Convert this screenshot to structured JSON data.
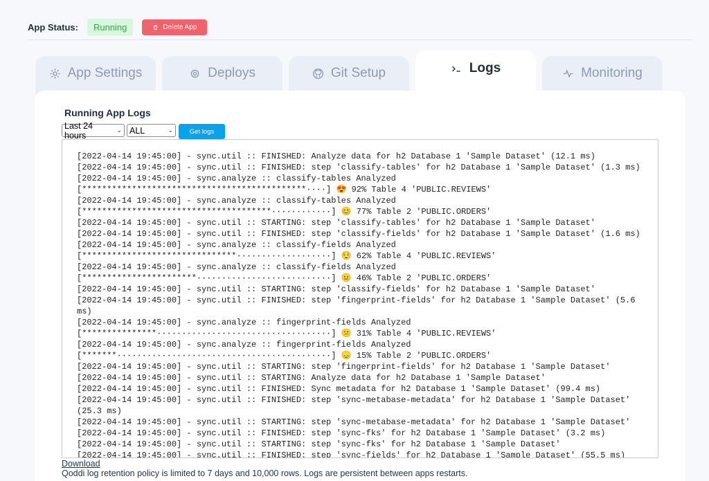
{
  "status": {
    "label": "App Status:",
    "badge": "Running",
    "badge_color": "#2ea84a",
    "delete_label": "Delete App",
    "delete_color": "#f0626c"
  },
  "tabs": [
    {
      "label": "App Settings",
      "icon": "gear-icon",
      "active": false
    },
    {
      "label": "Deploys",
      "icon": "target-icon",
      "active": false
    },
    {
      "label": "Git Setup",
      "icon": "github-icon",
      "active": false
    },
    {
      "label": "Logs",
      "icon": "terminal-icon",
      "active": true
    },
    {
      "label": "Monitoring",
      "icon": "activity-icon",
      "active": false
    }
  ],
  "logs": {
    "title": "Running App Logs",
    "range_value": "Last 24 hours",
    "level_value": "ALL",
    "get_logs_label": "Get logs",
    "accent": "#0aa3eb",
    "lines": [
      "[2022-04-14 19:45:00] - sync.util :: FINISHED: Analyze data for h2 Database 1 'Sample Dataset' (12.1 ms)",
      "[2022-04-14 19:45:00] - sync.util :: FINISHED: step 'classify-tables' for h2 Database 1 'Sample Dataset' (1.3 ms)",
      "[2022-04-14 19:45:00] - sync.analyze :: classify-tables Analyzed",
      "[*********************************************····] 😍 92% Table 4 'PUBLIC.REVIEWS'",
      "[2022-04-14 19:45:00] - sync.analyze :: classify-tables Analyzed",
      "[**************************************············] 😊 77% Table 2 'PUBLIC.ORDERS'",
      "[2022-04-14 19:45:00] - sync.util :: STARTING: step 'classify-tables' for h2 Database 1 'Sample Dataset'",
      "[2022-04-14 19:45:00] - sync.util :: FINISHED: step 'classify-fields' for h2 Database 1 'Sample Dataset' (1.6 ms)",
      "[2022-04-14 19:45:00] - sync.analyze :: classify-fields Analyzed",
      "[*******************************···················] 😌 62% Table 4 'PUBLIC.REVIEWS'",
      "[2022-04-14 19:45:00] - sync.analyze :: classify-fields Analyzed",
      "[***********************···························] 😐 46% Table 2 'PUBLIC.ORDERS'",
      "[2022-04-14 19:45:00] - sync.util :: STARTING: step 'classify-fields' for h2 Database 1 'Sample Dataset'",
      "[2022-04-14 19:45:00] - sync.util :: FINISHED: step 'fingerprint-fields' for h2 Database 1 'Sample Dataset' (5.6 ms)",
      "[2022-04-14 19:45:00] - sync.analyze :: fingerprint-fields Analyzed",
      "[***************···································] 😕 31% Table 4 'PUBLIC.REVIEWS'",
      "[2022-04-14 19:45:00] - sync.analyze :: fingerprint-fields Analyzed",
      "[*******···········································] 😞 15% Table 2 'PUBLIC.ORDERS'",
      "[2022-04-14 19:45:00] - sync.util :: STARTING: step 'fingerprint-fields' for h2 Database 1 'Sample Dataset'",
      "[2022-04-14 19:45:00] - sync.util :: STARTING: Analyze data for h2 Database 1 'Sample Dataset'",
      "[2022-04-14 19:45:00] - sync.util :: FINISHED: Sync metadata for h2 Database 1 'Sample Dataset' (99.4 ms)",
      "[2022-04-14 19:45:00] - sync.util :: FINISHED: step 'sync-metabase-metadata' for h2 Database 1 'Sample Dataset' (25.3 ms)",
      "[2022-04-14 19:45:00] - sync.util :: STARTING: step 'sync-metabase-metadata' for h2 Database 1 'Sample Dataset'",
      "[2022-04-14 19:45:00] - sync.util :: FINISHED: step 'sync-fks' for h2 Database 1 'Sample Dataset' (3.2 ms)",
      "[2022-04-14 19:45:00] - sync.util :: STARTING: step 'sync-fks' for h2 Database 1 'Sample Dataset'",
      "[2022-04-14 19:45:00] - sync.util :: FINISHED: step 'sync-fields' for h2 Database 1 'Sample Dataset' (55.5 ms)"
    ],
    "download_label": "Download",
    "retention_note": "Qoddi log retention policy is limited to 7 days and 10,000 rows. Logs are persistent between apps restarts."
  }
}
